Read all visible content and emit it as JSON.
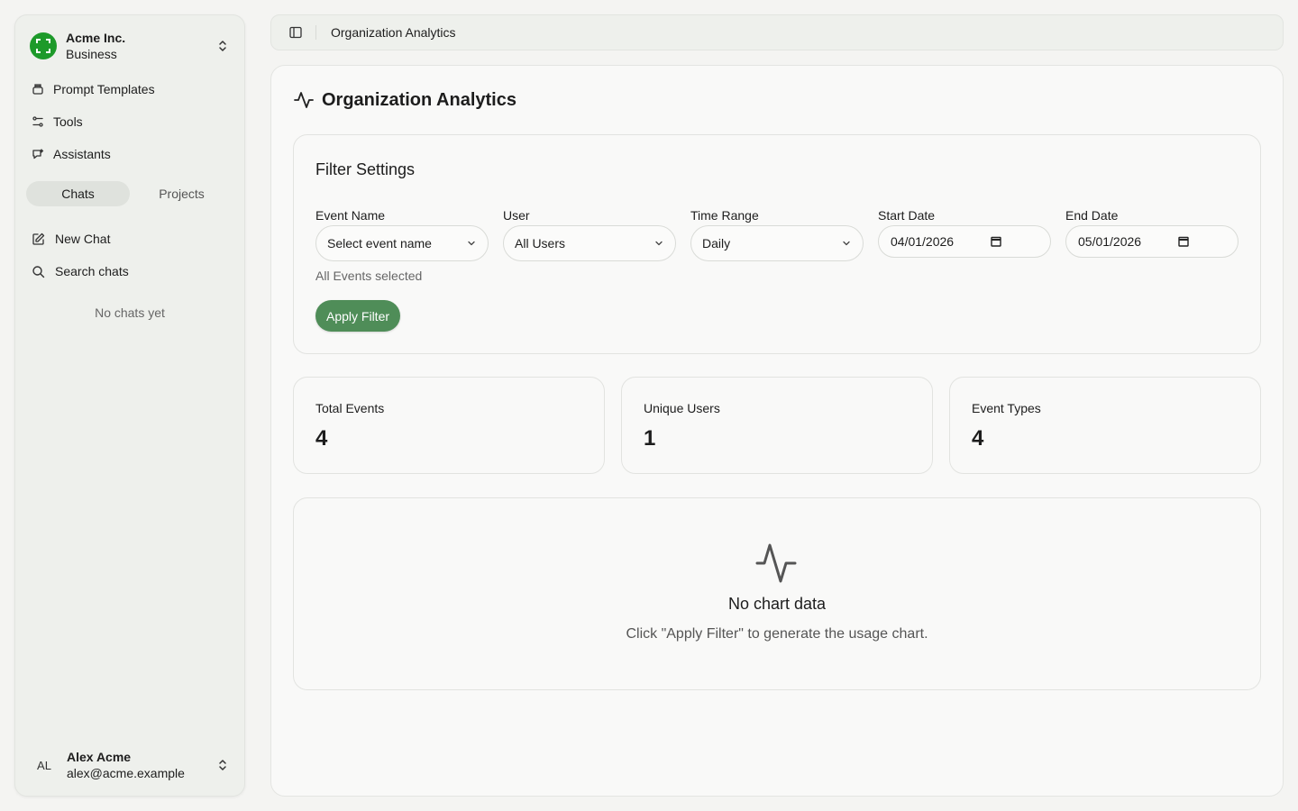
{
  "sidebar": {
    "org": {
      "name": "Acme Inc.",
      "plan": "Business"
    },
    "nav": [
      {
        "label": "Prompt Templates",
        "icon": "prompt-template-icon"
      },
      {
        "label": "Tools",
        "icon": "tools-icon"
      },
      {
        "label": "Assistants",
        "icon": "assistant-icon"
      }
    ],
    "tabs": [
      {
        "label": "Chats",
        "active": true
      },
      {
        "label": "Projects",
        "active": false
      }
    ],
    "actions": [
      {
        "label": "New Chat",
        "icon": "edit-icon"
      },
      {
        "label": "Search chats",
        "icon": "search-icon"
      }
    ],
    "empty_text": "No chats yet",
    "user": {
      "initials": "AL",
      "name": "Alex Acme",
      "email": "alex@acme.example"
    }
  },
  "topbar": {
    "breadcrumb": "Organization Analytics"
  },
  "main": {
    "title": "Organization Analytics",
    "filter": {
      "title": "Filter Settings",
      "event_name": {
        "label": "Event Name",
        "value": "Select event name"
      },
      "user": {
        "label": "User",
        "value": "All Users"
      },
      "time_range": {
        "label": "Time Range",
        "value": "Daily"
      },
      "start_date": {
        "label": "Start Date",
        "value": "04/01/2026"
      },
      "end_date": {
        "label": "End Date",
        "value": "05/01/2026"
      },
      "hint": "All Events selected",
      "apply_label": "Apply Filter"
    },
    "stats": [
      {
        "label": "Total Events",
        "value": "4"
      },
      {
        "label": "Unique Users",
        "value": "1"
      },
      {
        "label": "Event Types",
        "value": "4"
      }
    ],
    "chart_empty": {
      "title": "No chart data",
      "subtitle": "Click \"Apply Filter\" to generate the usage chart."
    }
  },
  "colors": {
    "accent": "#4f8d58",
    "logo": "#1d9a2a",
    "background": "#f4f4f2"
  }
}
